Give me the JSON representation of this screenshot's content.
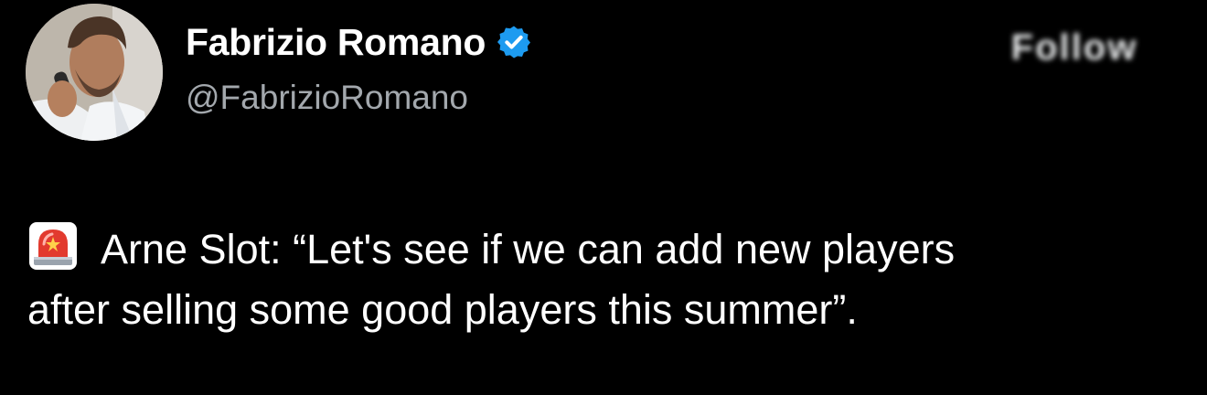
{
  "author": {
    "display_name": "Fabrizio Romano",
    "handle": "@FabrizioRomano",
    "verified": true,
    "verified_color": "#1d9bf0"
  },
  "header_button": {
    "label": "Follow",
    "obscured": true
  },
  "tweet": {
    "emoji_icon": "rotating-light-icon",
    "line1": "Arne Slot: “Let's see if we can add new players",
    "line2": "after selling some good players this summer”."
  },
  "colors": {
    "background": "#000000",
    "text": "#ffffff",
    "secondary_text": "#a3a8ad"
  }
}
